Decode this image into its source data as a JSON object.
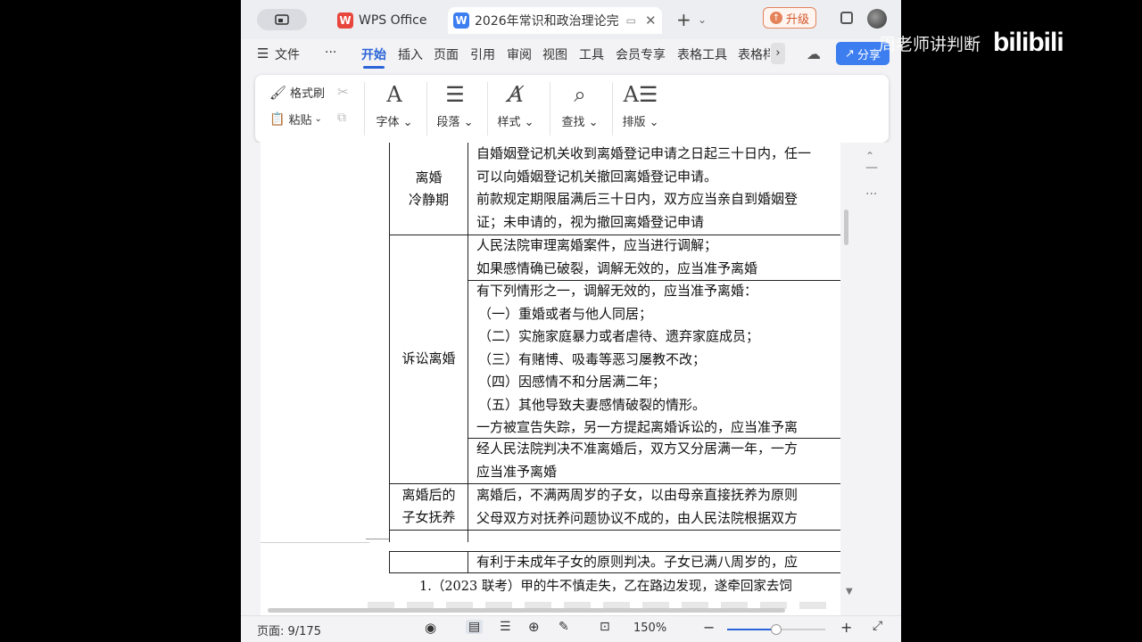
{
  "tabs": {
    "wps_label": "WPS Office",
    "doc_label": "2026年常识和政治理论完",
    "new_tab": "+",
    "upgrade_label": "升级"
  },
  "menu": {
    "file": "文件",
    "more": "···",
    "items": [
      "开始",
      "插入",
      "页面",
      "引用",
      "审阅",
      "视图",
      "工具",
      "会员专享",
      "表格工具",
      "表格样"
    ],
    "share": "分享"
  },
  "ribbon": {
    "format_painter": "格式刷",
    "paste": "粘贴",
    "font": "字体",
    "paragraph": "段落",
    "style": "样式",
    "find": "查找",
    "layout": "排版"
  },
  "document": {
    "rows": [
      {
        "title_lines": [
          "离婚",
          "冷静期"
        ],
        "lines": [
          "自婚姻登记机关收到离婚登记申请之日起三十日内，任一",
          "可以向婚姻登记机关撤回离婚登记申请。",
          "前款规定期限届满后三十日内，双方应当亲自到婚姻登",
          "证；未申请的，视为撤回离婚登记申请"
        ]
      },
      {
        "title_lines": [
          "诉讼离婚"
        ],
        "blocks": [
          [
            "人民法院审理离婚案件，应当进行调解；",
            "如果感情确已破裂，调解无效的，应当准予离婚"
          ],
          [
            "有下列情形之一，调解无效的，应当准予离婚：",
            "（一）重婚或者与他人同居；",
            "（二）实施家庭暴力或者虐待、遗弃家庭成员；",
            "（三）有赌博、吸毒等恶习屡教不改；",
            "（四）因感情不和分居满二年；",
            "（五）其他导致夫妻感情破裂的情形。",
            "一方被宣告失踪，另一方提起离婚诉讼的，应当准予离"
          ],
          [
            "经人民法院判决不准离婚后，双方又分居满一年，一方",
            "应当准予离婚"
          ]
        ]
      },
      {
        "title_lines": [
          "离婚后的",
          "子女抚养"
        ],
        "lines": [
          "离婚后，不满两周岁的子女，以由母亲直接抚养为原则",
          "父母双方对抚养问题协议不成的，由人民法院根据双方"
        ]
      }
    ],
    "continued_row": "有利于未成年子女的原则判决。子女已满八周岁的，应",
    "question_line": "1.（2023 联考）甲的牛不慎走失，乙在路边发现，遂牵回家去饲"
  },
  "status": {
    "page": "页面: 9/175",
    "zoom": "150%",
    "zoom_level": 0.5
  },
  "watermark": {
    "text": "周老师讲判断",
    "logo": "bilibili"
  },
  "colors": {
    "accent": "#2a64d8",
    "wps_logo": "#e8453c",
    "doc_logo": "#3c7ef0",
    "upgrade": "#d2562c"
  }
}
